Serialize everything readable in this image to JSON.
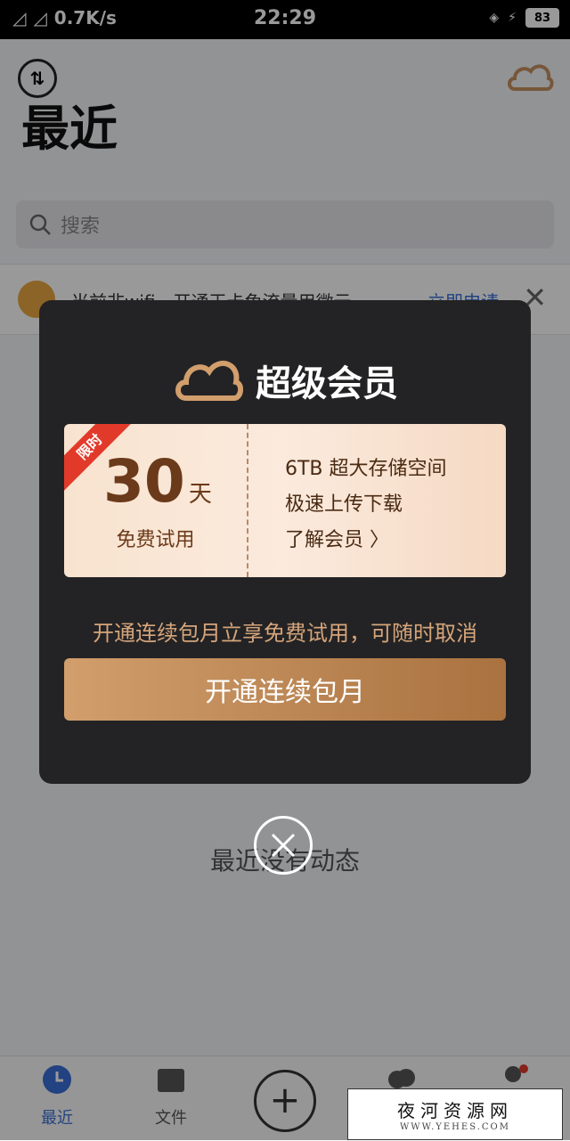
{
  "status_bar": {
    "net_speed": "0.7K/s",
    "time": "22:29",
    "battery": "83"
  },
  "page": {
    "title": "最近",
    "search_placeholder": "搜索",
    "empty_text": "最近没有动态"
  },
  "banner": {
    "text": "当前非wifi，开通王卡免流量用微云",
    "apply_label": "立即申请"
  },
  "dialog": {
    "title": "超级会员",
    "ribbon": "限时",
    "days_value": "30",
    "days_unit": "天",
    "free_trial": "免费试用",
    "features": [
      "6TB 超大存储空间",
      "极速上传下载",
      "了解会员 〉"
    ],
    "subline": "开通连续包月立享免费试用，可随时取消",
    "cta_label": "开通连续包月"
  },
  "tabbar": {
    "items": [
      "最近",
      "文件",
      "照片",
      "我的"
    ]
  },
  "watermark": {
    "text": "夜河资源网",
    "url": "WWW.YEHES.COM"
  },
  "colors": {
    "accent_gold": "#d19e6c",
    "ribbon_red": "#e23a2a",
    "tab_active": "#3a6fd8"
  }
}
